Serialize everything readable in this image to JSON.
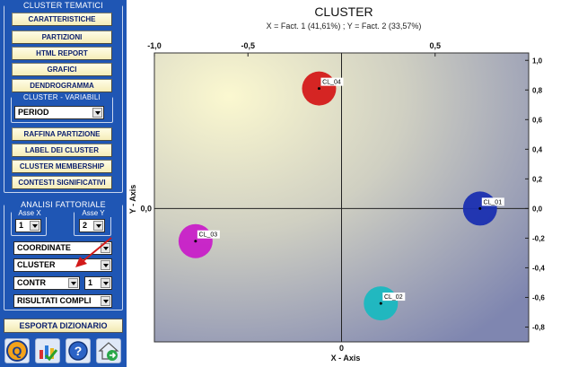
{
  "sidebar": {
    "cluster_tematici_title": "CLUSTER TEMATICI",
    "buttons_top": [
      "CARATTERISTICHE",
      "PARTIZIONI",
      "HTML REPORT",
      "GRAFICI",
      "DENDROGRAMMA"
    ],
    "cluster_variabili_title": "CLUSTER - VARIABILI",
    "variabili_select": "PERIOD",
    "buttons_mid": [
      "RAFFINA PARTIZIONE",
      "LABEL DEI CLUSTER",
      "CLUSTER MEMBERSHIP",
      "CONTESTI SIGNIFICATIVI"
    ],
    "analisi_title": "ANALISI FATTORIALE",
    "asse_x_label": "Asse X",
    "asse_y_label": "Asse Y",
    "asse_x_value": "1",
    "asse_y_value": "2",
    "coordinate_select": "COORDINATE",
    "cluster_select": "CLUSTER",
    "contr_select": "CONTR",
    "contr_num_select": "1",
    "risultati_select": "RISULTATI COMPLI",
    "export_button": "ESPORTA DIZIONARIO",
    "icons": [
      "q-logo-icon",
      "chart-check-icon",
      "help-icon",
      "home-export-icon"
    ]
  },
  "chart_data": {
    "type": "scatter",
    "title": "CLUSTER",
    "subtitle": "X = Fact. 1 (41,61%) ; Y = Fact. 2 (33,57%)",
    "xlabel": "X - Axis",
    "ylabel": "Y - Axis",
    "xlim": [
      -1.0,
      1.0
    ],
    "ylim": [
      -0.9,
      1.05
    ],
    "x_ticks": [
      "-1,0",
      "-0,5",
      "0",
      "0,5"
    ],
    "x_tick_values": [
      -1.0,
      -0.5,
      0,
      0.5
    ],
    "y_ticks": [
      "1,0",
      "0,8",
      "0,6",
      "0,4",
      "0,2",
      "0,0",
      "-0,2",
      "-0,4",
      "-0,6",
      "-0,8"
    ],
    "y_tick_values": [
      1.0,
      0.8,
      0.6,
      0.4,
      0.2,
      0.0,
      -0.2,
      -0.4,
      -0.6,
      -0.8
    ],
    "points": [
      {
        "label": "CL_04",
        "x": -0.12,
        "y": 0.81,
        "color": "#d41a1a"
      },
      {
        "label": "CL_01",
        "x": 0.74,
        "y": 0.0,
        "color": "#1a2fb0"
      },
      {
        "label": "CL_03",
        "x": -0.78,
        "y": -0.22,
        "color": "#c81fc8"
      },
      {
        "label": "CL_02",
        "x": 0.21,
        "y": -0.64,
        "color": "#1ab8c0"
      }
    ]
  }
}
